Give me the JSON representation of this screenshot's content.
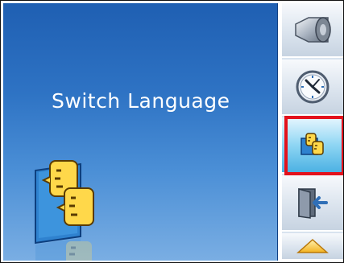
{
  "main": {
    "title": "Switch Language"
  },
  "sidebar": {
    "items": [
      {
        "icon": "speaker-icon",
        "selected": false
      },
      {
        "icon": "clock-icon",
        "selected": false
      },
      {
        "icon": "switch-language-icon",
        "selected": true
      },
      {
        "icon": "exit-door-icon",
        "selected": false
      },
      {
        "icon": "scroll-up-arrow-icon",
        "selected": false
      }
    ]
  },
  "colors": {
    "panel_top": "#1f5fb2",
    "panel_bottom": "#7aaee3",
    "highlight": "#e3111b",
    "selected_bg": "#4cb1e3"
  }
}
